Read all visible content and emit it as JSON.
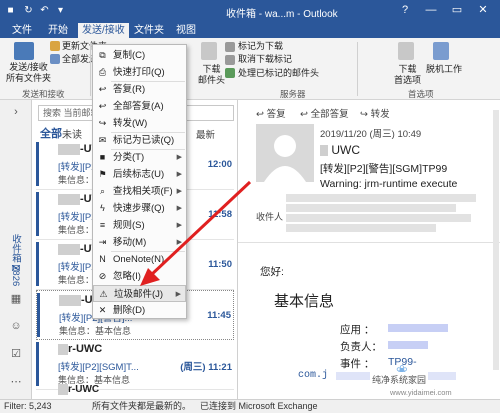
{
  "window": {
    "title": "收件箱 - wa...m - Outlook",
    "controls": [
      "?",
      "—",
      "▭",
      "✕"
    ]
  },
  "tabs": [
    "文件",
    "开始",
    "发送/接收",
    "文件夹",
    "视图"
  ],
  "active_tab": "发送/接收",
  "ribbon": {
    "send_receive": "发送/接收\n所有文件夹",
    "update_folder": "更新文件夹",
    "send_all": "全部发送",
    "group1": "发送和接收",
    "download_headers": "下载\n邮件头",
    "mark_download": "标记为下载",
    "unmark_download": "取消下载标记",
    "process_marked": "处理已标记的邮件头",
    "group2": "服务器",
    "download_prefs": "下载\n首选项",
    "offline": "脱机工作",
    "group3": "首选项"
  },
  "nav": {
    "folder_label": "收件箱 2826"
  },
  "maillist": {
    "search_placeholder": "搜索 当前邮箱",
    "filter_all": "全部",
    "filter_unread": "未读",
    "sort": "最新",
    "messages": [
      {
        "sender": "UWC",
        "subject": "[转发][P2]警告]...",
        "time": "12:00",
        "preview": "集信息：基本 信息"
      },
      {
        "sender": "UWC",
        "subject": "[转发][P2][警告]...",
        "time": "11:58",
        "preview": "集信息：基本信息"
      },
      {
        "sender": "UWC",
        "subject": "[转发][P2]...",
        "time": "11:50",
        "preview": "集信息：基本信息"
      },
      {
        "sender": "UWC",
        "subject": "[转发][P2][警告]...",
        "time": "11:45",
        "preview": "集信息：基本信息"
      },
      {
        "sender": "r-UWC",
        "subject": "[转发][P2][SGM]T...",
        "time": "(周三) 11:21",
        "preview": "集信息：基本信息"
      },
      {
        "sender": "r-UWC",
        "subject": "",
        "time": "",
        "preview": ""
      }
    ]
  },
  "context_menu": [
    {
      "label": "复制(C)",
      "icon": "copy-icon",
      "glyph": "⧉",
      "sub": false
    },
    {
      "label": "快速打印(Q)",
      "icon": "print-icon",
      "glyph": "⎙",
      "sub": false
    },
    {
      "label": "答复(R)",
      "icon": "reply-icon",
      "glyph": "↩",
      "sub": false
    },
    {
      "label": "全部答复(A)",
      "icon": "reply-all-icon",
      "glyph": "↩",
      "sub": false
    },
    {
      "label": "转发(W)",
      "icon": "forward-icon",
      "glyph": "↪",
      "sub": false
    },
    {
      "label": "标记为已读(Q)",
      "icon": "mark-read-icon",
      "glyph": "✉",
      "sub": false
    },
    {
      "label": "分类(T)",
      "icon": "categorize-icon",
      "glyph": "■",
      "sub": true
    },
    {
      "label": "后续标志(U)",
      "icon": "flag-icon",
      "glyph": "⚑",
      "sub": true
    },
    {
      "label": "查找相关项(F)",
      "icon": "find-related-icon",
      "glyph": "⌕",
      "sub": true
    },
    {
      "label": "快速步骤(Q)",
      "icon": "quick-steps-icon",
      "glyph": "ϟ",
      "sub": true
    },
    {
      "label": "规则(S)",
      "icon": "rules-icon",
      "glyph": "≡",
      "sub": true
    },
    {
      "label": "移动(M)",
      "icon": "move-icon",
      "glyph": "⇥",
      "sub": true
    },
    {
      "label": "OneNote(N)",
      "icon": "onenote-icon",
      "glyph": "N",
      "sub": false
    },
    {
      "label": "忽略(I)",
      "icon": "ignore-icon",
      "glyph": "⊘",
      "sub": false
    },
    {
      "label": "垃圾邮件(J)",
      "icon": "junk-icon",
      "glyph": "⚠",
      "sub": true
    },
    {
      "label": "删除(D)",
      "icon": "delete-icon",
      "glyph": "✕",
      "sub": false
    }
  ],
  "reading": {
    "actions": [
      "答复",
      "全部答复",
      "转发"
    ],
    "date": "2019/11/20 (周三) 10:49",
    "sender": "UWC",
    "subject": "[转发][P2][警告][SGM]TP99",
    "warning": "Warning: jrm-runtime execute",
    "recipient_label": "收件人",
    "greeting": "您好:",
    "heading": "基本信息",
    "fields": [
      {
        "label": "应用 ：",
        "value": ""
      },
      {
        "label": "负责人：",
        "value": ""
      },
      {
        "label": "事件 ：",
        "value": "TP99-"
      }
    ],
    "code": "com.j"
  },
  "status": {
    "items": "Filter: 5,243",
    "sync": "所有文件夹都是最新的。",
    "connection": "已连接到 Microsoft Exchange"
  },
  "watermark": {
    "brand": "纯净系统家园",
    "url": "www.yidaimei.com"
  },
  "colors": {
    "accent": "#2b579a",
    "arrow": "#e02020"
  }
}
